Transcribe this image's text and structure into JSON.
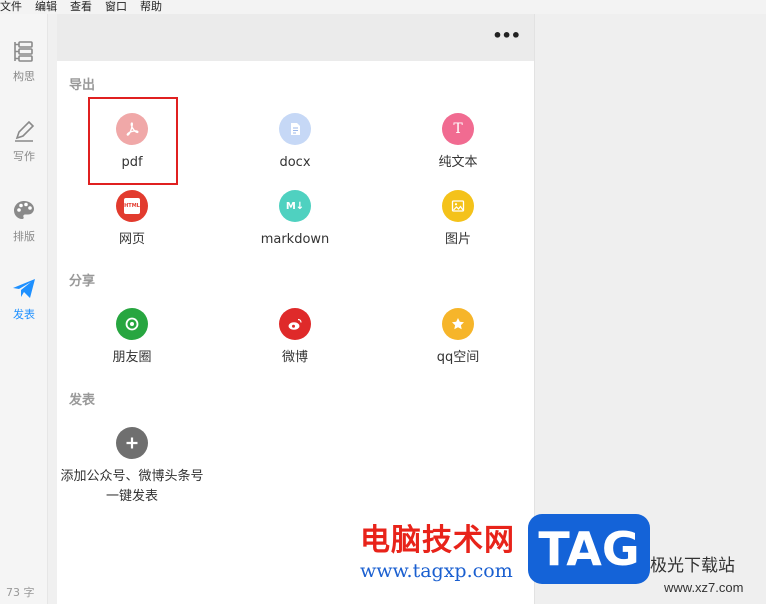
{
  "menubar": {
    "items": [
      "文件",
      "编辑",
      "查看",
      "窗口",
      "帮助"
    ]
  },
  "sidebar": {
    "items": [
      {
        "label": "构思"
      },
      {
        "label": "写作"
      },
      {
        "label": "排版"
      },
      {
        "label": "发表"
      }
    ],
    "active": "发表",
    "active_color": "#1e90ff",
    "word_count": "73 字"
  },
  "toolbar": {
    "more_label": "•••"
  },
  "panel": {
    "export": {
      "title": "导出",
      "items": [
        {
          "label": "pdf",
          "icon": "pdf-icon",
          "color": "#f0a8a8"
        },
        {
          "label": "docx",
          "icon": "docx-icon",
          "color": "#c6d8f6"
        },
        {
          "label": "纯文本",
          "icon": "text-icon",
          "color": "#f16b91",
          "glyph": "T"
        },
        {
          "label": "网页",
          "icon": "html-icon",
          "color": "#e23b2e",
          "glyph": "HTML"
        },
        {
          "label": "markdown",
          "icon": "markdown-icon",
          "color": "#4fd1c0",
          "glyph": "M↓"
        },
        {
          "label": "图片",
          "icon": "image-icon",
          "color": "#f4c21a"
        }
      ]
    },
    "share": {
      "title": "分享",
      "items": [
        {
          "label": "朋友圈",
          "icon": "moments-icon",
          "color": "#27a640"
        },
        {
          "label": "微博",
          "icon": "weibo-icon",
          "color": "#df2a2a"
        },
        {
          "label": "qq空间",
          "icon": "qzone-icon",
          "color": "#f6b52a"
        }
      ]
    },
    "publish": {
      "title": "发表",
      "add_label_line1": "添加公众号、微博头条号",
      "add_label_line2": "一键发表",
      "icon": "add-icon",
      "color": "#6f6f6f"
    }
  },
  "watermark": {
    "cn_text": "电脑技术网",
    "url": "www.tagxp.com",
    "tag": "TAG",
    "site_cn": "极光下载站",
    "site_url": "www.xz7.com"
  }
}
